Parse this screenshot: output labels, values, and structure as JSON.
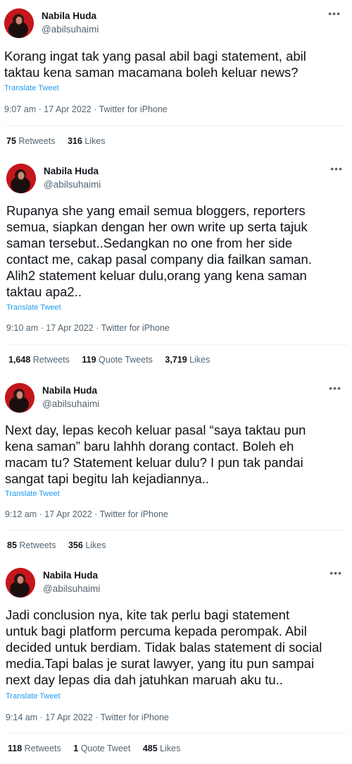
{
  "tweets": [
    {
      "author_name": "Nabila Huda",
      "handle": "@abilsuhaimi",
      "text": "Korang ingat tak yang pasal abil bagi statement, abil\ntaktau kena saman macamana boleh keluar news?",
      "translate_label": "Translate Tweet",
      "timestamp": "9:07 am · 17 Apr 2022 · Twitter for iPhone",
      "retweets_count": "75",
      "retweets_label": "Retweets",
      "quote_count": "",
      "quote_label": "",
      "likes_count": "316",
      "likes_label": "Likes"
    },
    {
      "author_name": "Nabila Huda",
      "handle": "@abilsuhaimi",
      "text": "Rupanya she yang email semua bloggers, reporters\nsemua, siapkan dengan her own write up serta tajuk\nsaman tersebut..Sedangkan no one from her side\ncontact me, cakap pasal company dia failkan saman.\nAlih2 statement keluar dulu,orang yang kena saman\ntaktau apa2..",
      "translate_label": "Translate Tweet",
      "timestamp": "9:10 am · 17 Apr 2022 · Twitter for iPhone",
      "retweets_count": "1,648",
      "retweets_label": "Retweets",
      "quote_count": "119",
      "quote_label": "Quote Tweets",
      "likes_count": "3,719",
      "likes_label": "Likes"
    },
    {
      "author_name": "Nabila Huda",
      "handle": "@abilsuhaimi",
      "text": "Next day, lepas kecoh keluar pasal “saya taktau pun\nkena saman” baru lahhh dorang contact. Boleh eh\nmacam tu? Statement keluar dulu? I pun tak pandai\nsangat tapi begitu lah kejadiannya..",
      "translate_label": "Translate Tweet",
      "timestamp": "9:12 am · 17 Apr 2022 · Twitter for iPhone",
      "retweets_count": "85",
      "retweets_label": "Retweets",
      "quote_count": "",
      "quote_label": "",
      "likes_count": "356",
      "likes_label": "Likes"
    },
    {
      "author_name": "Nabila Huda",
      "handle": "@abilsuhaimi",
      "text": "Jadi conclusion nya, kite tak perlu bagi statement\nuntuk bagi platform percuma kepada perompak. Abil\ndecided untuk berdiam. Tidak balas statement di social\nmedia.Tapi balas je surat lawyer, yang itu pun sampai\nnext day lepas dia dah jatuhkan maruah aku tu..",
      "translate_label": "Translate Tweet",
      "timestamp": "9:14 am · 17 Apr 2022 · Twitter for iPhone",
      "retweets_count": "118",
      "retweets_label": "Retweets",
      "quote_count": "1",
      "quote_label": "Quote Tweet",
      "likes_count": "485",
      "likes_label": "Likes"
    }
  ],
  "icons": {
    "avatar": "profile-avatar",
    "more": "more-options-icon"
  },
  "colors": {
    "text": "#0f1419",
    "secondary": "#536471",
    "link": "#1d9bf0",
    "avatar_bg": "#c4161c"
  }
}
